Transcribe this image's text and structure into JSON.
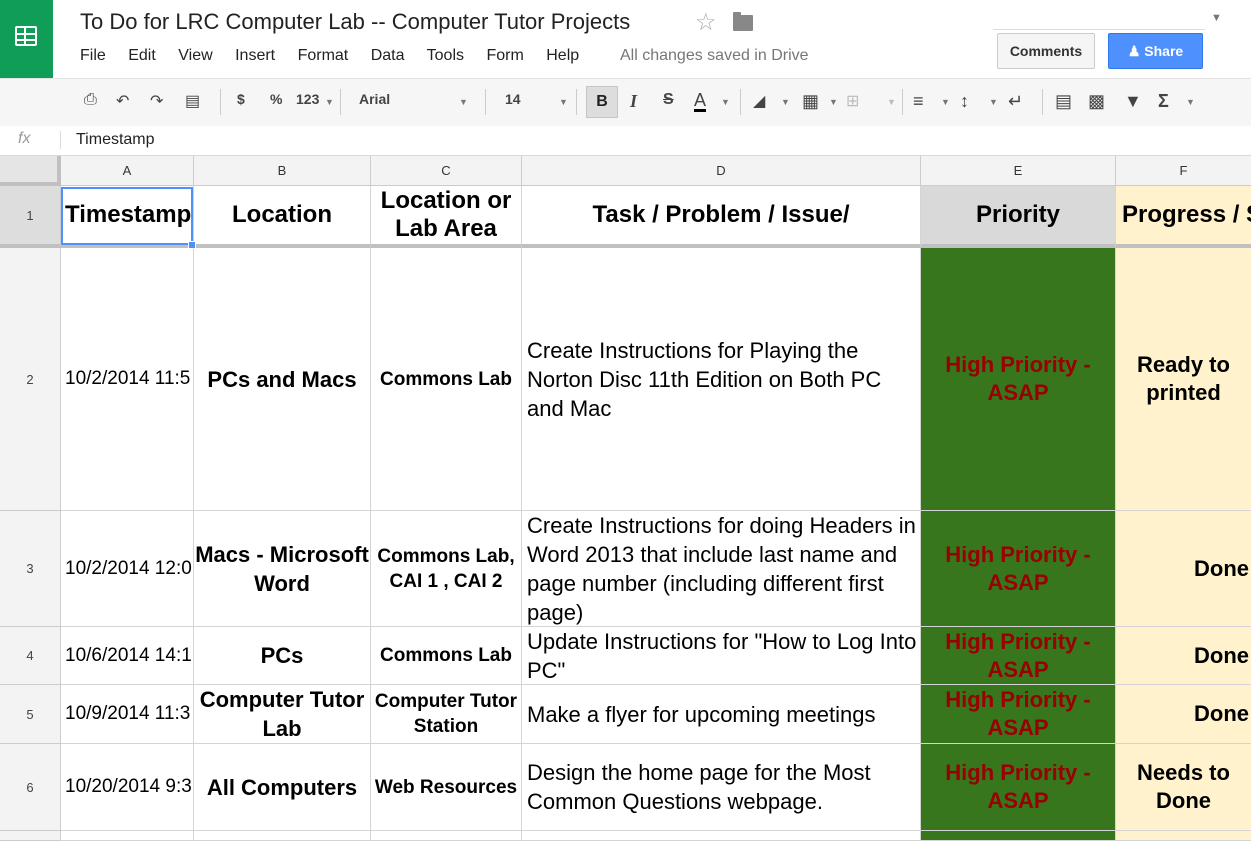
{
  "doc": {
    "title": "To Do for LRC Computer Lab -- Computer Tutor Projects",
    "save_status": "All changes saved in Drive"
  },
  "menu": [
    "File",
    "Edit",
    "View",
    "Insert",
    "Format",
    "Data",
    "Tools",
    "Form",
    "Help"
  ],
  "buttons": {
    "comments": "Comments",
    "share": "Share"
  },
  "toolbar": {
    "currency": "$",
    "percent": "%",
    "more_formats": "123",
    "font": "Arial",
    "font_size": "14",
    "bold": "B",
    "italic": "I",
    "strike": "S",
    "text_color": "A"
  },
  "formula_bar": {
    "label": "fx",
    "value": "Timestamp"
  },
  "columns": [
    "A",
    "B",
    "C",
    "D",
    "E",
    "F"
  ],
  "rows": [
    "1",
    "2",
    "3",
    "4",
    "5",
    "6"
  ],
  "header": {
    "timestamp": "Timestamp",
    "location": "Location",
    "area": "Location or Lab Area",
    "task": "Task / Problem / Issue/",
    "priority": "Priority",
    "progress": "Progress / S"
  },
  "records": [
    {
      "timestamp": "10/2/2014 11:5",
      "location": "PCs and Macs",
      "area": "Commons Lab",
      "task": "Create Instructions for Playing the Norton Disc 11th Edition on Both PC and Mac",
      "priority": "High Priority - ASAP",
      "progress": "Ready to printed"
    },
    {
      "timestamp": "10/2/2014 12:0",
      "location": "Macs - Microsoft Word",
      "area": "Commons Lab, CAI 1 , CAI 2",
      "task": "Create Instructions for doing Headers in Word 2013 that include last name and page number (including different first page)",
      "priority": "High Priority - ASAP",
      "progress": "Done"
    },
    {
      "timestamp": "10/6/2014 14:1",
      "location": "PCs",
      "area": "Commons Lab",
      "task": "Update Instructions for \"How to Log Into PC\"",
      "priority": "High Priority - ASAP",
      "progress": "Done"
    },
    {
      "timestamp": "10/9/2014 11:3",
      "location": "Computer Tutor Lab",
      "area": "Computer Tutor Station",
      "task": "Make a flyer for upcoming meetings",
      "priority": "High Priority - ASAP",
      "progress": "Done"
    },
    {
      "timestamp": "10/20/2014 9:3",
      "location": "All Computers",
      "area": "Web Resources",
      "task": "Design the home page for the Most Common Questions webpage.",
      "priority": "High Priority - ASAP",
      "progress": "Needs to Done"
    }
  ],
  "colors": {
    "priority_fill": "#38761d",
    "priority_text": "#990000",
    "progress_fill": "#fff2cc",
    "brand": "#0f9d58",
    "share": "#4d90fe"
  }
}
